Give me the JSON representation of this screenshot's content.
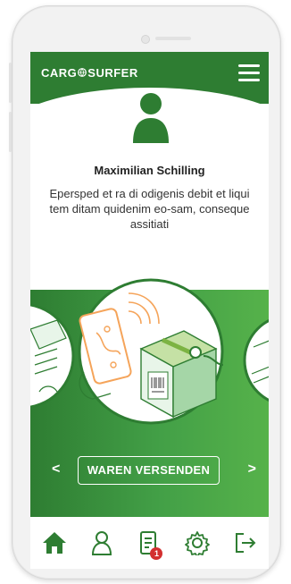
{
  "header": {
    "logo_left": "CARG",
    "logo_right": "SURFER",
    "menu_icon": "hamburger-menu-icon"
  },
  "profile": {
    "name": "Maximilian Schilling",
    "description": "Epersped et ra di odigenis debit et liqui tem ditam quidenim eo-sam, conseque assitiati"
  },
  "carousel": {
    "prev": "<",
    "next": ">",
    "cta_label": "WAREN VERSENDEN"
  },
  "nav": {
    "items": [
      {
        "icon": "home-icon",
        "active": true
      },
      {
        "icon": "user-icon"
      },
      {
        "icon": "document-icon",
        "badge": "1"
      },
      {
        "icon": "settings-icon"
      },
      {
        "icon": "logout-icon"
      }
    ]
  },
  "colors": {
    "brand_green": "#2e7d32",
    "accent_green": "#4caf50",
    "illustration_orange": "#f5a45a",
    "badge_red": "#d32f2f"
  }
}
